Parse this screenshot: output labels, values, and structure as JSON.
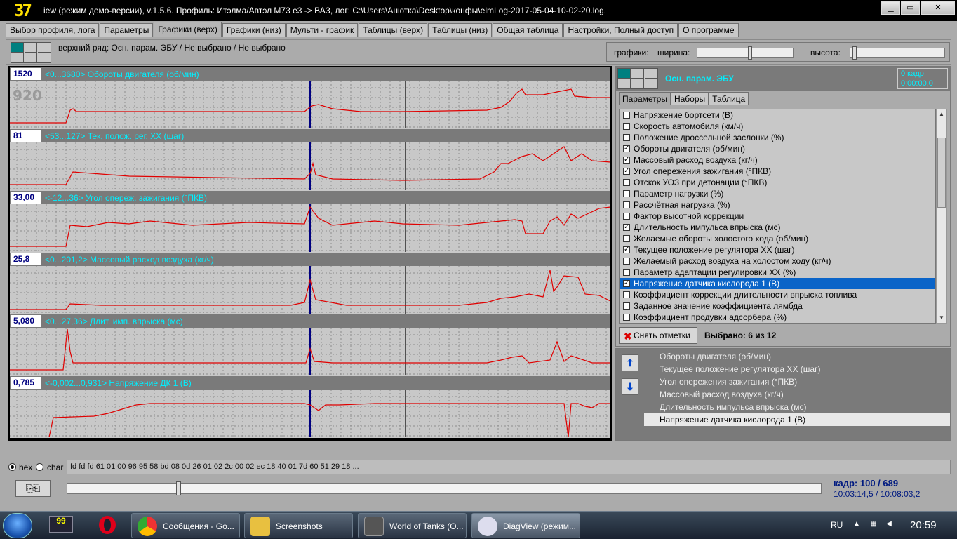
{
  "window": {
    "logo": "37",
    "title": "iew (режим демо-версии), v.1.5.6. Профиль: Итэлма/Автэл М73 е3 -> ВАЗ,   лог: C:\\Users\\Анютка\\Desktop\\конфы\\elmLog-2017-05-04-10-02-20.log.",
    "min_label": "▁",
    "max_label": "▭",
    "close_label": "✕"
  },
  "tabs": [
    "Выбор профиля, лога",
    "Параметры",
    "Графики (верх)",
    "Графики (низ)",
    "Мульти - график",
    "Таблицы (верх)",
    "Таблицы (низ)",
    "Общая таблица",
    "Настройки, Полный доступ",
    "О программе"
  ],
  "active_tab": "Графики (верх)",
  "info": {
    "top_row_label": "верхний ряд: Осн. парам. ЭБУ / Не выбрано / Не выбрано",
    "charts_label": "графики:",
    "width_label": "ширина:",
    "height_label": "высота:",
    "width_value": 0.55,
    "height_value": 0.02
  },
  "charts": [
    {
      "value": "1520",
      "name": "<0...3680> Обороты двигателя (об/мин)"
    },
    {
      "value": "81",
      "name": "<53...127> Тек. полож. рег. ХХ (шаг)"
    },
    {
      "value": "33,00",
      "name": "<-12...36> Угол опереж. зажигания (°ПКВ)"
    },
    {
      "value": "25,8",
      "name": "<0...201,2> Массовый расход воздуха (кг/ч)"
    },
    {
      "value": "5,080",
      "name": "<0...27,36> Длит. имп. впрыска (мс)"
    },
    {
      "value": "0,785",
      "name": "<-0,002...0,931> Напряжение ДК 1 (В)"
    }
  ],
  "big_value": "920",
  "right_panel": {
    "title": "Осн. парам. ЭБУ",
    "frame_label": "0 кадр",
    "frame_time": "0:00:00,0",
    "subtabs": [
      "Параметры",
      "Наборы",
      "Таблица"
    ],
    "active_subtab": "Параметры",
    "params": [
      {
        "label": "Напряжение бортсети (В)",
        "checked": false
      },
      {
        "label": "Скорость автомобиля (км/ч)",
        "checked": false
      },
      {
        "label": "Положение дроссельной заслонки (%)",
        "checked": false
      },
      {
        "label": "Обороты двигателя (об/мин)",
        "checked": true
      },
      {
        "label": "Массовый расход воздуха (кг/ч)",
        "checked": true
      },
      {
        "label": "Угол опережения зажигания (°ПКВ)",
        "checked": true
      },
      {
        "label": "Отскок УОЗ при детонации (°ПКВ)",
        "checked": false
      },
      {
        "label": "Параметр нагрузки (%)",
        "checked": false
      },
      {
        "label": "Рассчётная нагрузка (%)",
        "checked": false
      },
      {
        "label": "Фактор высотной коррекции",
        "checked": false
      },
      {
        "label": "Длительность импульса впрыска (мс)",
        "checked": true
      },
      {
        "label": "Желаемые обороты холостого хода (об/мин)",
        "checked": false
      },
      {
        "label": "Текущее положение регулятора ХХ (шаг)",
        "checked": true
      },
      {
        "label": "Желаемый расход воздуха на холостом ходу (кг/ч)",
        "checked": false
      },
      {
        "label": "Параметр адаптации регулировки ХХ (%)",
        "checked": false
      },
      {
        "label": "Напряжение датчика кислорода 1 (В)",
        "checked": true,
        "selected": true
      },
      {
        "label": "Коэффициент коррекции длительности впрыска топлива",
        "checked": false
      },
      {
        "label": "Заданное значение коэффициента лямбда",
        "checked": false
      },
      {
        "label": "Коэффициент продувки адсорбера (%)",
        "checked": false
      }
    ],
    "clear_label": "Снять отметки",
    "selected_count": "Выбрано: 6 из 12"
  },
  "selected_list": [
    "Обороты двигателя (об/мин)",
    "Текущее положение регулятора ХХ (шаг)",
    "Угол опережения зажигания (°ПКВ)",
    "Массовый расход воздуха (кг/ч)",
    "Длительность импульса впрыска (мс)",
    "Напряжение датчика кислорода 1 (В)"
  ],
  "bottom": {
    "hex_label": "hex",
    "char_label": "char",
    "hex_data": "fd fd fd 61 01 00 96 95 58 bd 08 0d 26 01 02 2c 00 02 ec 18 40 01 7d 60 51 29 18 ...",
    "frame_counter": "кадр: 100 / 689",
    "frame_times": "10:03:14,5 / 10:08:03,2",
    "position": 0.145
  },
  "taskbar": {
    "tasks": [
      "Сообщения - Go...",
      "Screenshots",
      "World of Tanks (O...",
      "DiagView (режим..."
    ],
    "lang": "RU",
    "clock": "20:59",
    "badge": "99"
  },
  "colors": {
    "cursor_blue": "#000080",
    "trace_red": "#e00000",
    "label_cyan": "#00f0ff",
    "selection": "#0a64c8"
  }
}
